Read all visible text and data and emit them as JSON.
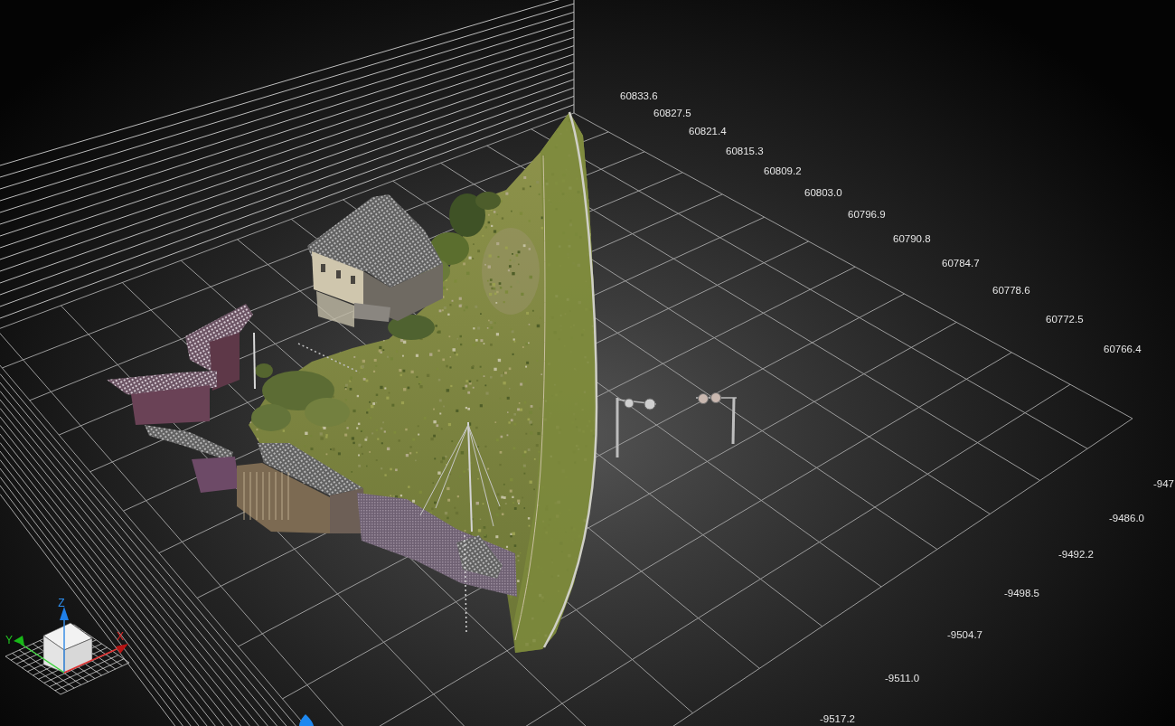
{
  "viewport": {
    "x_axis_labels": [
      "60833.6",
      "60827.5",
      "60821.4",
      "60815.3",
      "60809.2",
      "60803.0",
      "60796.9",
      "60790.8",
      "60784.7",
      "60778.6",
      "60772.5",
      "60766.4"
    ],
    "y_axis_labels": [
      "-947",
      "-9486.0",
      "-9492.2",
      "-9498.5",
      "-9504.7",
      "-9511.0",
      "-9517.2"
    ],
    "view_gizmo": {
      "axes": [
        {
          "kind": "z",
          "label": "Z"
        },
        {
          "kind": "y",
          "label": "Y"
        },
        {
          "kind": "x",
          "label": "X"
        }
      ]
    }
  }
}
